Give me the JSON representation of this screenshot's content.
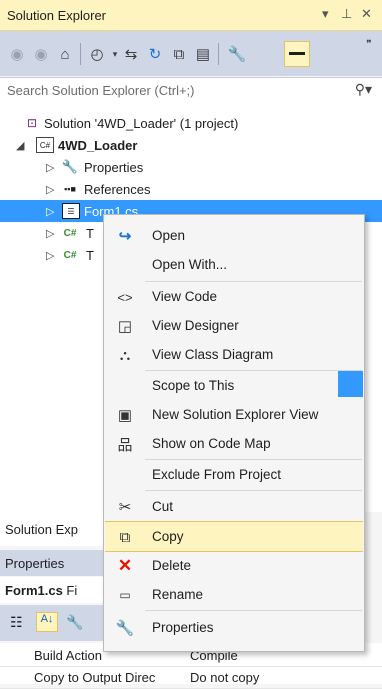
{
  "title_bar": {
    "title": "Solution Explorer",
    "dropdown": "▾",
    "pin": "⊥",
    "close": "✕"
  },
  "search": {
    "placeholder": "Search Solution Explorer (Ctrl+;)",
    "icon": "search-icon"
  },
  "tree": {
    "solution": "Solution '4WD_Loader' (1 project)",
    "project": "4WD_Loader",
    "properties": "Properties",
    "references": "References",
    "form1_visible": "Form1.cs",
    "item_a_prefix": "T",
    "item_b_prefix": "T"
  },
  "lower": {
    "se_tab": "Solution Exp",
    "props_title": "Properties",
    "props_obj_bold": "Form1.cs",
    "props_obj_rest": " Fi"
  },
  "grid": {
    "rows": [
      {
        "key": "Build Action",
        "value": "Compile"
      },
      {
        "key": "Copy to Output Direc",
        "value": "Do not copy"
      }
    ]
  },
  "context_menu": {
    "items": [
      {
        "label": "Open",
        "icon": "open-icon"
      },
      {
        "label": "Open With...",
        "icon": ""
      },
      {
        "label": "View Code",
        "icon": "view-code-icon"
      },
      {
        "label": "View Designer",
        "icon": "view-designer-icon"
      },
      {
        "label": "View Class Diagram",
        "icon": "class-diagram-icon"
      },
      {
        "label": "Scope to This",
        "icon": ""
      },
      {
        "label": "New Solution Explorer View",
        "icon": "new-view-icon"
      },
      {
        "label": "Show on Code Map",
        "icon": "code-map-icon"
      },
      {
        "label": "Exclude From Project",
        "icon": ""
      },
      {
        "label": "Cut",
        "icon": "cut-icon"
      },
      {
        "label": "Copy",
        "icon": "copy-icon"
      },
      {
        "label": "Delete",
        "icon": "delete-icon"
      },
      {
        "label": "Rename",
        "icon": "rename-icon"
      },
      {
        "label": "Properties",
        "icon": "wrench-icon"
      }
    ],
    "highlighted": "Copy"
  },
  "colors": {
    "accent": "#3399ff",
    "title_bg": "#fdf4bf",
    "toolbar_bg": "#cfd6e5",
    "delete_red": "#e51400"
  }
}
